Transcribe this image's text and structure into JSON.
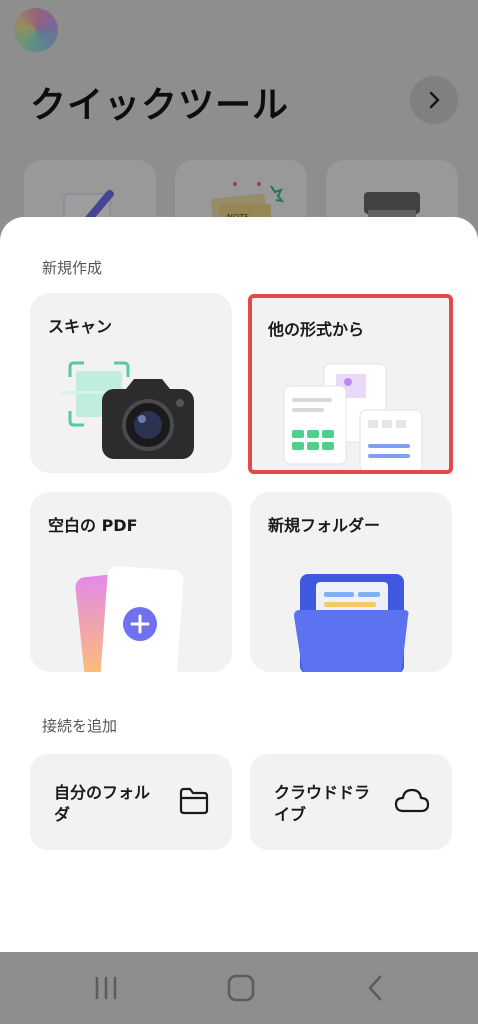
{
  "background": {
    "title": "クイックツール",
    "tools": [
      "edit-tool-icon",
      "sticky-note-tool-icon",
      "scanner-tool-icon"
    ]
  },
  "sheet": {
    "new_section": "新規作成",
    "cards": [
      {
        "label": "スキャン",
        "icon": "camera-scan-icon"
      },
      {
        "label": "他の形式から",
        "icon": "other-formats-icon"
      },
      {
        "label": "空白の PDF",
        "icon": "blank-pdf-icon"
      },
      {
        "label": "新規フォルダー",
        "icon": "new-folder-icon"
      }
    ],
    "connect_section": "接続を追加",
    "connections": [
      {
        "label": "自分のフォルダ",
        "icon": "folder-icon"
      },
      {
        "label": "クラウドドライブ",
        "icon": "cloud-icon"
      }
    ]
  },
  "colors": {
    "selection_outline": "#e54848",
    "card_bg": "#f2f2f2",
    "accent_purple": "#6f71f0",
    "folder_blue": "#4560e8"
  }
}
